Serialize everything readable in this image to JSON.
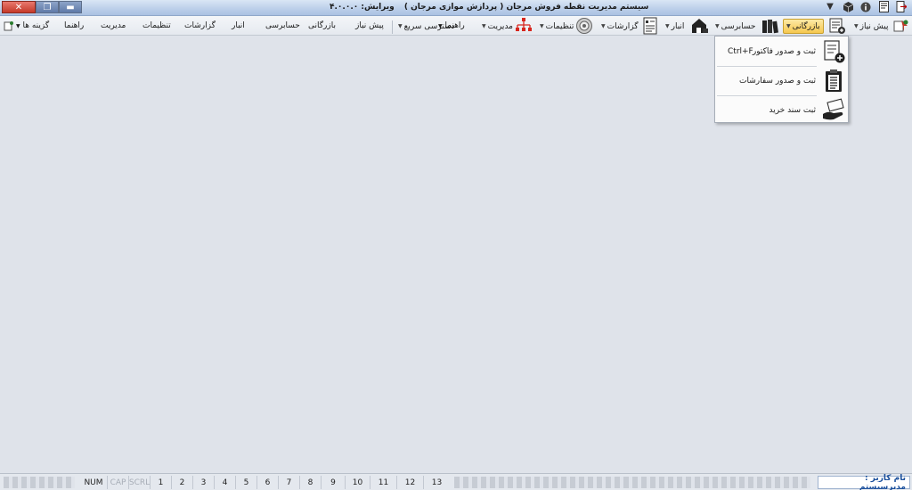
{
  "window": {
    "title": "سیستم مدیریت نقطه فروش مرجان ( پردازش موازی مرجان )",
    "version": "ویرایش: ۴.۰.۰.۰",
    "close_glyph": "✕",
    "restore_glyph": "❐",
    "minimize_glyph": "▬"
  },
  "menubar": {
    "items": [
      {
        "label": "پیش نیاز",
        "arrow": "▼"
      },
      {
        "label": "بازرگانی",
        "arrow": "▼"
      },
      {
        "label": "حسابرسی",
        "arrow": "▼"
      },
      {
        "label": "انبار",
        "arrow": "▼"
      },
      {
        "label": "گزارشات",
        "arrow": "▼"
      },
      {
        "label": "تنظیمات",
        "arrow": "▼"
      },
      {
        "label": "مدیریت",
        "arrow": "▼"
      },
      {
        "label": "دسترسی سریع",
        "arrow": "▼"
      },
      {
        "label": "راهنما",
        "arrow": "▼"
      },
      {
        "label": "گزینه ها",
        "arrow": "▼"
      }
    ],
    "classic": {
      "items": [
        "پیش نیاز",
        "بازرگانی",
        "حسابرسی",
        "انبار",
        "گزارشات",
        "تنظیمات",
        "مدیریت",
        "راهنما"
      ],
      "left_label": "گزینه ها"
    }
  },
  "dropdown": {
    "items": [
      {
        "label": "ثبت و صدور فاکتور",
        "shortcut": "Ctrl+F",
        "icon": "invoice-add-icon"
      },
      {
        "label": "ثبت و صدور سفارشات",
        "shortcut": "",
        "icon": "clipboard-list-icon"
      },
      {
        "label": "ثبت سند خرید",
        "shortcut": "",
        "icon": "purchase-hand-icon"
      }
    ]
  },
  "statusbar": {
    "user": "نام کاربر : مدیرسیستم",
    "locks": [
      "NUM",
      "CAP",
      "SCRL"
    ],
    "tabs": [
      "1",
      "2",
      "3",
      "4",
      "5",
      "6",
      "7",
      "8",
      "9",
      "10",
      "11",
      "12",
      "13"
    ]
  },
  "colors": {
    "workspace": "#dfe3ea",
    "active_menu": "#f6c84f",
    "user_text": "#1a4f9c",
    "close_button": "#c53a2a"
  }
}
